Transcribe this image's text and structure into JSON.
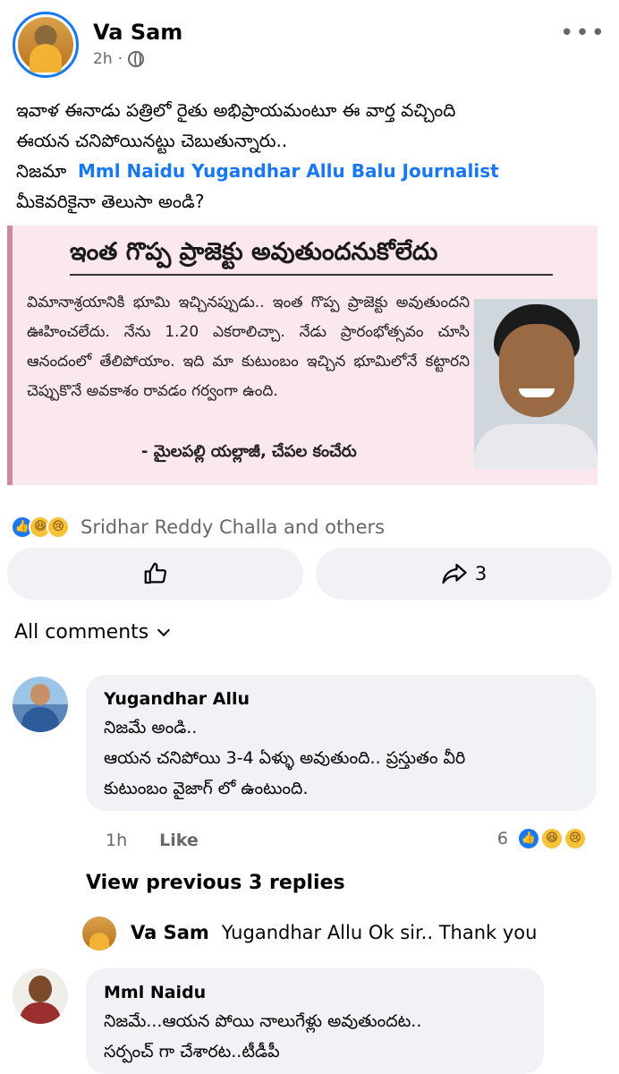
{
  "post": {
    "author": "Va Sam",
    "time": "2h",
    "separator": "·",
    "more_icon": "ellipsis-icon",
    "text_line1": "ఇవాళ ఈనాడు పత్రిలో రైతు అభిప్రాయమంటూ ఈ వార్త వచ్చింది",
    "text_line2": "ఈయన చనిపోయినట్టు చెబుతున్నారు..",
    "text_line3_prefix": "నిజమా",
    "mentions": "Mml Naidu Yugandhar Allu Balu Journalist",
    "text_line4": "మీకెవరికైనా తెలుసా అండి?"
  },
  "clipping": {
    "headline": "ఇంత గొప్ప ప్రాజెక్టు అవుతుందనుకోలేదు",
    "body": "విమానాశ్రయానికి భూమి ఇచ్చినప్పుడు.. ఇంత గొప్ప ప్రాజెక్టు అవుతుందని ఊహించలేదు. నేను 1.20 ఎకరాలిచ్చా. నేడు ప్రారంభోత్సవం చూసి ఆనందంలో తేలిపోయాం. ఇది మా కుటుంబం ఇచ్చిన భూమిలోనే కట్టారని చెప్పుకొనే అవకాశం రావడం గర్వంగా ఉంది.",
    "byline": "- మైలపల్లి యల్లాజీ, చేపల కంచేరు"
  },
  "reactions": {
    "names": "Sridhar Reddy Challa and others",
    "icons": [
      "like-reaction-icon",
      "haha-reaction-icon",
      "sad-reaction-icon"
    ]
  },
  "actions": {
    "share_count": "3"
  },
  "comments_filter": "All comments",
  "comments": [
    {
      "name": "Yugandhar Allu",
      "line1": "నిజమే అండి..",
      "line2": "ఆయన చనిపోయి 3-4 ఏళ్ళు అవుతుంది.. ప్రస్తుతం వీరి",
      "line3": "కుటుంబం వైజాగ్ లో ఉంటుంది.",
      "time": "1h",
      "like_label": "Like",
      "reaction_count": "6"
    },
    {
      "name": "Mml Naidu",
      "line1": "నిజమే...ఆయన పోయి నాలుగేళ్లు అవుతుందట..",
      "line2": "సర్పంచ్ గా చేశారట..టీడీపీ"
    }
  ],
  "view_previous": "View previous 3 replies",
  "reply": {
    "name": "Va Sam",
    "text": "Yugandhar Allu Ok sir.. Thank you"
  },
  "colors": {
    "link": "#1877f2",
    "muted": "#65676b",
    "bubble": "#f0f2f5"
  }
}
